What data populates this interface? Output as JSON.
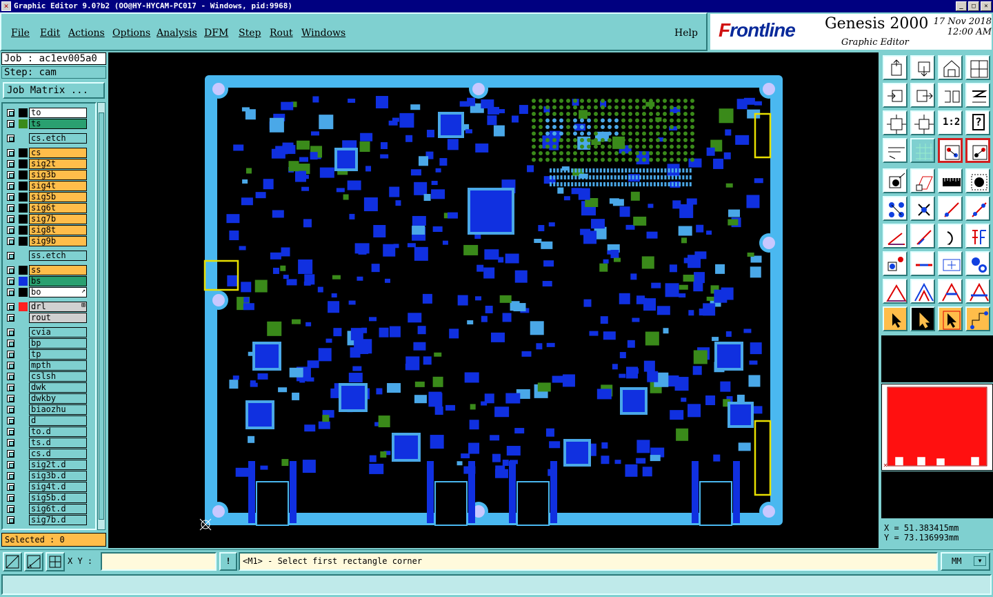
{
  "window": {
    "title": "Graphic Editor 9.0?b2 (OO@HY-HYCAM-PC017 - Windows, pid:9968)",
    "controls": {
      "min": "_",
      "max": "□",
      "close": "✕"
    }
  },
  "menu": {
    "items": [
      "File",
      "Edit",
      "Actions",
      "Options",
      "Analysis",
      "DFM",
      "Step",
      "Rout",
      "Windows"
    ],
    "help": "Help"
  },
  "brand": {
    "logo_prefix": "F",
    "logo_rest": "rontline",
    "product": "Genesis 2000",
    "subtitle": "Graphic Editor",
    "date": "17 Nov 2018",
    "time": "12:00 AM"
  },
  "job": {
    "job_label": "Job : ac1ev005a0",
    "step_label": "Step: cam",
    "matrix_button": "Job Matrix ..."
  },
  "layers": [
    {
      "name": "to",
      "fill": "#ffffff",
      "swatch": "#000000"
    },
    {
      "name": "ts",
      "fill": "#2aa070",
      "swatch": "#3a8a1a"
    },
    {
      "name": "cs.etch",
      "fill": "#7fd0d0",
      "swatch": "#7fd0d0",
      "gap": true
    },
    {
      "name": "cs",
      "fill": "#ffbd4a",
      "swatch": "#000000",
      "gap": true
    },
    {
      "name": "sig2t",
      "fill": "#ffbd4a",
      "swatch": "#000000"
    },
    {
      "name": "sig3b",
      "fill": "#ffbd4a",
      "swatch": "#000000"
    },
    {
      "name": "sig4t",
      "fill": "#ffbd4a",
      "swatch": "#000000"
    },
    {
      "name": "sig5b",
      "fill": "#ffbd4a",
      "swatch": "#000000"
    },
    {
      "name": "sig6t",
      "fill": "#ffbd4a",
      "swatch": "#000000"
    },
    {
      "name": "sig7b",
      "fill": "#ffbd4a",
      "swatch": "#000000"
    },
    {
      "name": "sig8t",
      "fill": "#ffbd4a",
      "swatch": "#000000"
    },
    {
      "name": "sig9b",
      "fill": "#ffbd4a",
      "swatch": "#000000"
    },
    {
      "name": "ss.etch",
      "fill": "#7fd0d0",
      "swatch": "#7fd0d0",
      "gap": true
    },
    {
      "name": "ss",
      "fill": "#ffbd4a",
      "swatch": "#000000",
      "gap": true
    },
    {
      "name": "bs",
      "fill": "#2aa070",
      "swatch": "#1030e0"
    },
    {
      "name": "bo",
      "fill": "#ffffff",
      "swatch": "#000000",
      "mark": "↗"
    },
    {
      "name": "drl",
      "fill": "#d0d0d0",
      "swatch": "#ff2020",
      "gap": true,
      "mark": "⊞"
    },
    {
      "name": "rout",
      "fill": "#d0d0d0",
      "swatch": "#7fd0d0"
    },
    {
      "name": "cvia",
      "fill": "#7fd0d0",
      "swatch": "#7fd0d0",
      "gap": true
    },
    {
      "name": "bp",
      "fill": "#7fd0d0",
      "swatch": "#7fd0d0"
    },
    {
      "name": "tp",
      "fill": "#7fd0d0",
      "swatch": "#7fd0d0"
    },
    {
      "name": "mpth",
      "fill": "#7fd0d0",
      "swatch": "#7fd0d0"
    },
    {
      "name": "cslsh",
      "fill": "#7fd0d0",
      "swatch": "#7fd0d0"
    },
    {
      "name": "dwk",
      "fill": "#7fd0d0",
      "swatch": "#7fd0d0"
    },
    {
      "name": "dwkby",
      "fill": "#7fd0d0",
      "swatch": "#7fd0d0"
    },
    {
      "name": "biaozhu",
      "fill": "#7fd0d0",
      "swatch": "#7fd0d0"
    },
    {
      "name": "d",
      "fill": "#7fd0d0",
      "swatch": "#7fd0d0"
    },
    {
      "name": "to.d",
      "fill": "#7fd0d0",
      "swatch": "#7fd0d0"
    },
    {
      "name": "ts.d",
      "fill": "#7fd0d0",
      "swatch": "#7fd0d0"
    },
    {
      "name": "cs.d",
      "fill": "#7fd0d0",
      "swatch": "#7fd0d0"
    },
    {
      "name": "sig2t.d",
      "fill": "#7fd0d0",
      "swatch": "#7fd0d0"
    },
    {
      "name": "sig3b.d",
      "fill": "#7fd0d0",
      "swatch": "#7fd0d0"
    },
    {
      "name": "sig4t.d",
      "fill": "#7fd0d0",
      "swatch": "#7fd0d0"
    },
    {
      "name": "sig5b.d",
      "fill": "#7fd0d0",
      "swatch": "#7fd0d0"
    },
    {
      "name": "sig6t.d",
      "fill": "#7fd0d0",
      "swatch": "#7fd0d0"
    },
    {
      "name": "sig7b.d",
      "fill": "#7fd0d0",
      "swatch": "#7fd0d0"
    }
  ],
  "selected_label": "Selected : 0",
  "board": {
    "outline_color": "#4ab8f0",
    "pad_blue": "#1030e0",
    "pad_light": "#4aa8e8",
    "pad_green": "#3a8a1a",
    "highlight": "#e8e000",
    "hole": "#c8c8ff"
  },
  "tools": [
    "home-icon",
    "export-icon",
    "house-icon",
    "split-icon",
    "step-in-icon",
    "step-out-icon",
    "flip-icon",
    "ruler-icon",
    "fit-icon",
    "zoom-icon",
    "one-to-two-icon",
    "help-icon",
    "brush-icon",
    "grid-icon",
    "layers-icon",
    "layers-alt-icon",
    "fill-icon",
    "shape-icon",
    "measure-icon",
    "circle-icon",
    "nodes-icon",
    "cross-icon",
    "line-icon",
    "connect-icon",
    "angle-icon",
    "slash-icon",
    "arc-icon",
    "text-icon",
    "pad-icon",
    "minus-icon",
    "pattern-icon",
    "blob-icon",
    "triangle-icon",
    "triangle-alt-icon",
    "triangle-bar-icon",
    "triangle-filled-icon",
    "pointer-icon",
    "select-icon",
    "pointer-alt-icon",
    "route-icon"
  ],
  "tool_one_to_two_label": "1:2",
  "tool_help_label": "?",
  "coords": {
    "x": "X  = 51.383415mm",
    "y": "Y  = 73.136993mm"
  },
  "bottom": {
    "xy_label": "X Y :",
    "xy_value": "",
    "alert_button": "!",
    "prompt": "<M1> - Select first rectangle corner",
    "units": "MM",
    "units_arrow": "▼"
  }
}
